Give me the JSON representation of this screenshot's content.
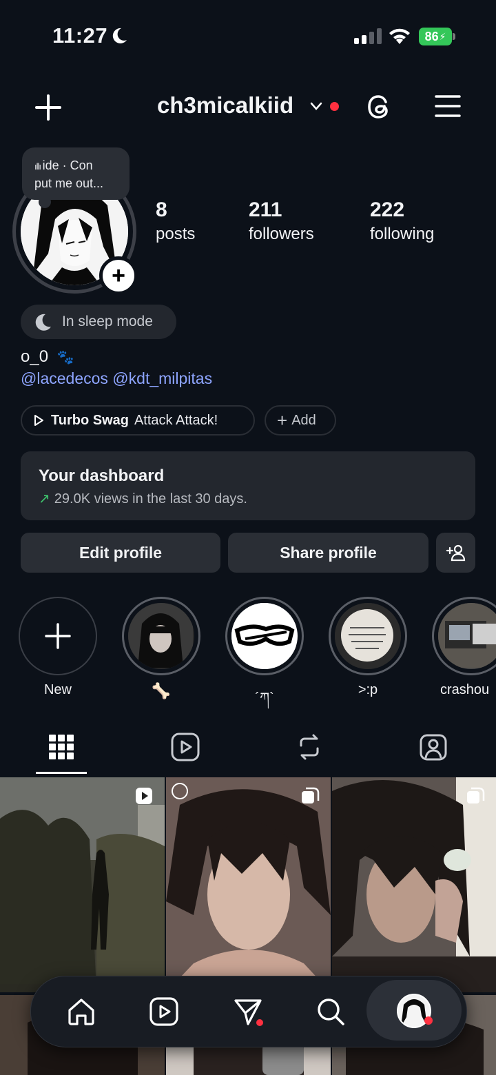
{
  "status_bar": {
    "time": "11:27",
    "battery": "86"
  },
  "header": {
    "username": "ch3micalkiid"
  },
  "note": {
    "line1": "ide · Con",
    "line2": "put me out..."
  },
  "stats": [
    {
      "number": "8",
      "label": "posts"
    },
    {
      "number": "211",
      "label": "followers"
    },
    {
      "number": "222",
      "label": "following"
    }
  ],
  "sleep_label": "In sleep mode",
  "bio": {
    "line1": "o_0",
    "mentions": "@lacedecos @kdt_milpitas"
  },
  "music": {
    "title": "Turbo Swag",
    "artist": "Attack Attack!"
  },
  "add_label": "Add",
  "dashboard": {
    "title": "Your dashboard",
    "subtitle": "29.0K views in the last 30 days."
  },
  "buttons": {
    "edit": "Edit profile",
    "share": "Share profile"
  },
  "highlights": [
    {
      "label": "New"
    },
    {
      "label": ""
    },
    {
      "label": "´ཀ`"
    },
    {
      "label": ">:p"
    },
    {
      "label": "crashou"
    }
  ],
  "colors": {
    "accent_link": "#8ea5ff",
    "notification": "#ff3040",
    "trend_up": "#3ec46d",
    "battery": "#34c759"
  }
}
